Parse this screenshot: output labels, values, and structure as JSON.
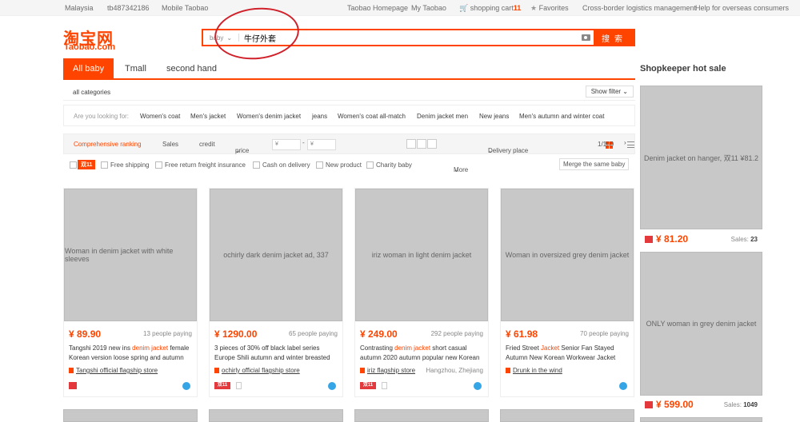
{
  "topbar": {
    "region": "Malaysia",
    "user": "tb487342186",
    "mobile": "Mobile Taobao",
    "homepage": "Taobao Homepage",
    "my_taobao": "My Taobao",
    "cart_label": "shopping cart",
    "cart_count": "11",
    "favorites": "Favorites",
    "crossborder": "Cross-border logistics management",
    "help": "Help for overseas consumers"
  },
  "logo": {
    "cn": "淘宝网",
    "en": "Taobao.com"
  },
  "search": {
    "category": "baby",
    "query": "牛仔外套",
    "button": "搜索"
  },
  "tabs": [
    "All baby",
    "Tmall",
    "second hand"
  ],
  "crumb": {
    "all_categories": "all categories",
    "show_filter": "Show filter"
  },
  "related": {
    "label": "Are you looking for:",
    "items": [
      "Women's coat",
      "Men's jacket",
      "Women's denim jacket",
      "jeans",
      "Women's coat all-match",
      "Denim jacket men",
      "New jeans",
      "Men's autumn and winter coat"
    ]
  },
  "sort": {
    "comprehensive": "Comprehensive ranking",
    "sales": "Sales",
    "credit": "credit",
    "price": "price",
    "price_min": "¥",
    "price_max": "¥",
    "dash": "-",
    "delivery": "Delivery place",
    "page": "1/100"
  },
  "filters": {
    "double11": "双11",
    "free_shipping": "Free shipping",
    "free_return": "Free return freight insurance",
    "cod": "Cash on delivery",
    "new_product": "New product",
    "charity": "Charity baby",
    "more": "More",
    "merge": "Merge the same baby"
  },
  "products": [
    {
      "price": "¥ 89.90",
      "paying": "13 people paying",
      "title_pre": "Tangshi 2019 new ins ",
      "title_hl": "denim jacket",
      "title_post": " female Korean version loose spring and autumn",
      "shop": "Tangshi official flagship store",
      "location": "",
      "img": "Woman in denim jacket with white sleeves"
    },
    {
      "price": "¥ 1290.00",
      "paying": "65 people paying",
      "title_pre": "3 pieces of 30% off black label series Europe Shili autumn and winter breasted",
      "title_hl": "",
      "title_post": "",
      "shop": "ochirly official flagship store",
      "location": "",
      "img": "ochirly dark denim jacket ad, 337"
    },
    {
      "price": "¥ 249.00",
      "paying": "292 people paying",
      "title_pre": "Contrasting ",
      "title_hl": "denim jacket",
      "title_post": " short casual autumn 2020 autumn popular new Korean",
      "shop": "iriz flagship store",
      "location": "Hangzhou, Zhejiang",
      "img": "iriz woman in light denim jacket"
    },
    {
      "price": "¥ 61.98",
      "paying": "70 people paying",
      "title_pre": "Fried Street ",
      "title_hl": "Jacket",
      "title_post": " Senior Fan Stayed Autumn New Korean Workwear Jacket",
      "shop": "Drunk in the wind",
      "location": "",
      "img": "Woman in oversized grey denim jacket"
    }
  ],
  "sidebar": {
    "title": "Shopkeeper hot sale",
    "items": [
      {
        "price": "¥ 81.20",
        "sales_label": "Sales:",
        "sales": "23",
        "img": "Denim jacket on hanger, 双11 ¥81.2"
      },
      {
        "price": "¥ 599.00",
        "sales_label": "Sales:",
        "sales": "1049",
        "img": "ONLY woman in grey denim jacket"
      }
    ]
  }
}
